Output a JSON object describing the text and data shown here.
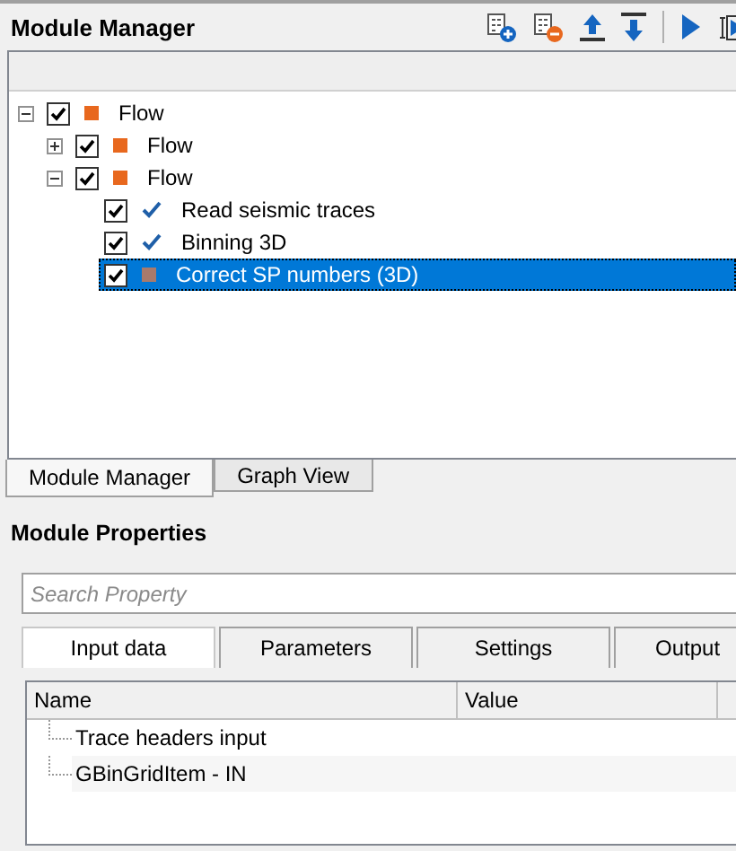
{
  "module_manager": {
    "title": "Module Manager",
    "tree": [
      {
        "label": "Flow",
        "kind": "flow",
        "checked": true,
        "expanded": true,
        "selected": false,
        "children": [
          {
            "label": "Flow",
            "kind": "flow",
            "checked": true,
            "expanded": false,
            "selected": false
          },
          {
            "label": "Flow",
            "kind": "flow",
            "checked": true,
            "expanded": true,
            "selected": false,
            "children": [
              {
                "label": "Read seismic traces",
                "kind": "done",
                "checked": true,
                "selected": false
              },
              {
                "label": "Binning 3D",
                "kind": "done",
                "checked": true,
                "selected": false
              },
              {
                "label": "Correct SP numbers (3D)",
                "kind": "pending",
                "checked": true,
                "selected": true
              }
            ]
          }
        ]
      }
    ]
  },
  "view_tabs": [
    {
      "label": "Module Manager",
      "selected": true
    },
    {
      "label": "Graph View",
      "selected": false
    }
  ],
  "module_properties": {
    "title": "Module Properties",
    "search": {
      "placeholder": "Search Property"
    },
    "tabs": [
      {
        "label": "Input data",
        "selected": true
      },
      {
        "label": "Parameters",
        "selected": false
      },
      {
        "label": "Settings",
        "selected": false
      },
      {
        "label": "Output",
        "selected": false
      }
    ],
    "table": {
      "columns": [
        "Name",
        "Value"
      ],
      "rows": [
        {
          "name": "Trace headers input"
        },
        {
          "name": "GBinGridItem - IN"
        }
      ]
    }
  }
}
